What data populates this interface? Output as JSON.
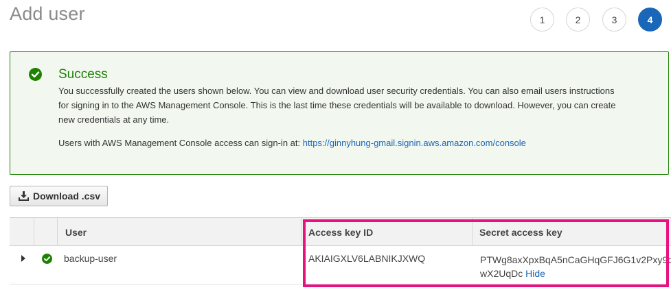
{
  "page": {
    "title": "Add user"
  },
  "steps": [
    "1",
    "2",
    "3",
    "4"
  ],
  "alert": {
    "title": "Success",
    "body": "You successfully created the users shown below. You can view and download user security credentials. You can also email users instructions for signing in to the AWS Management Console. This is the last time these credentials will be available to download. However, you can create new credentials at any time.",
    "console_prefix": "Users with AWS Management Console access can sign-in at: ",
    "console_url": "https://ginnyhung-gmail.signin.aws.amazon.com/console"
  },
  "toolbar": {
    "download_label": "Download .csv"
  },
  "table": {
    "headers": {
      "user": "User",
      "access_key": "Access key ID",
      "secret_key": "Secret access key"
    },
    "rows": [
      {
        "user": "backup-user",
        "access_key": "AKIAIGXLV6LABNIKJXWQ",
        "secret_line1": "PTWg8axXpxBqA5nCaGHqGFJ6G1v2Pxy9q",
        "secret_line2": "wX2UqDc",
        "hide_label": "Hide"
      }
    ]
  },
  "colors": {
    "success_green": "#1d8102",
    "alert_bg": "#f2f8f0",
    "active_step": "#1a66b8",
    "link": "#1a66b8",
    "highlight": "#e8117f"
  },
  "icons": {
    "alert": "check-circle-icon",
    "download": "download-icon",
    "expand": "caret-right-icon",
    "row_status": "check-circle-icon"
  }
}
